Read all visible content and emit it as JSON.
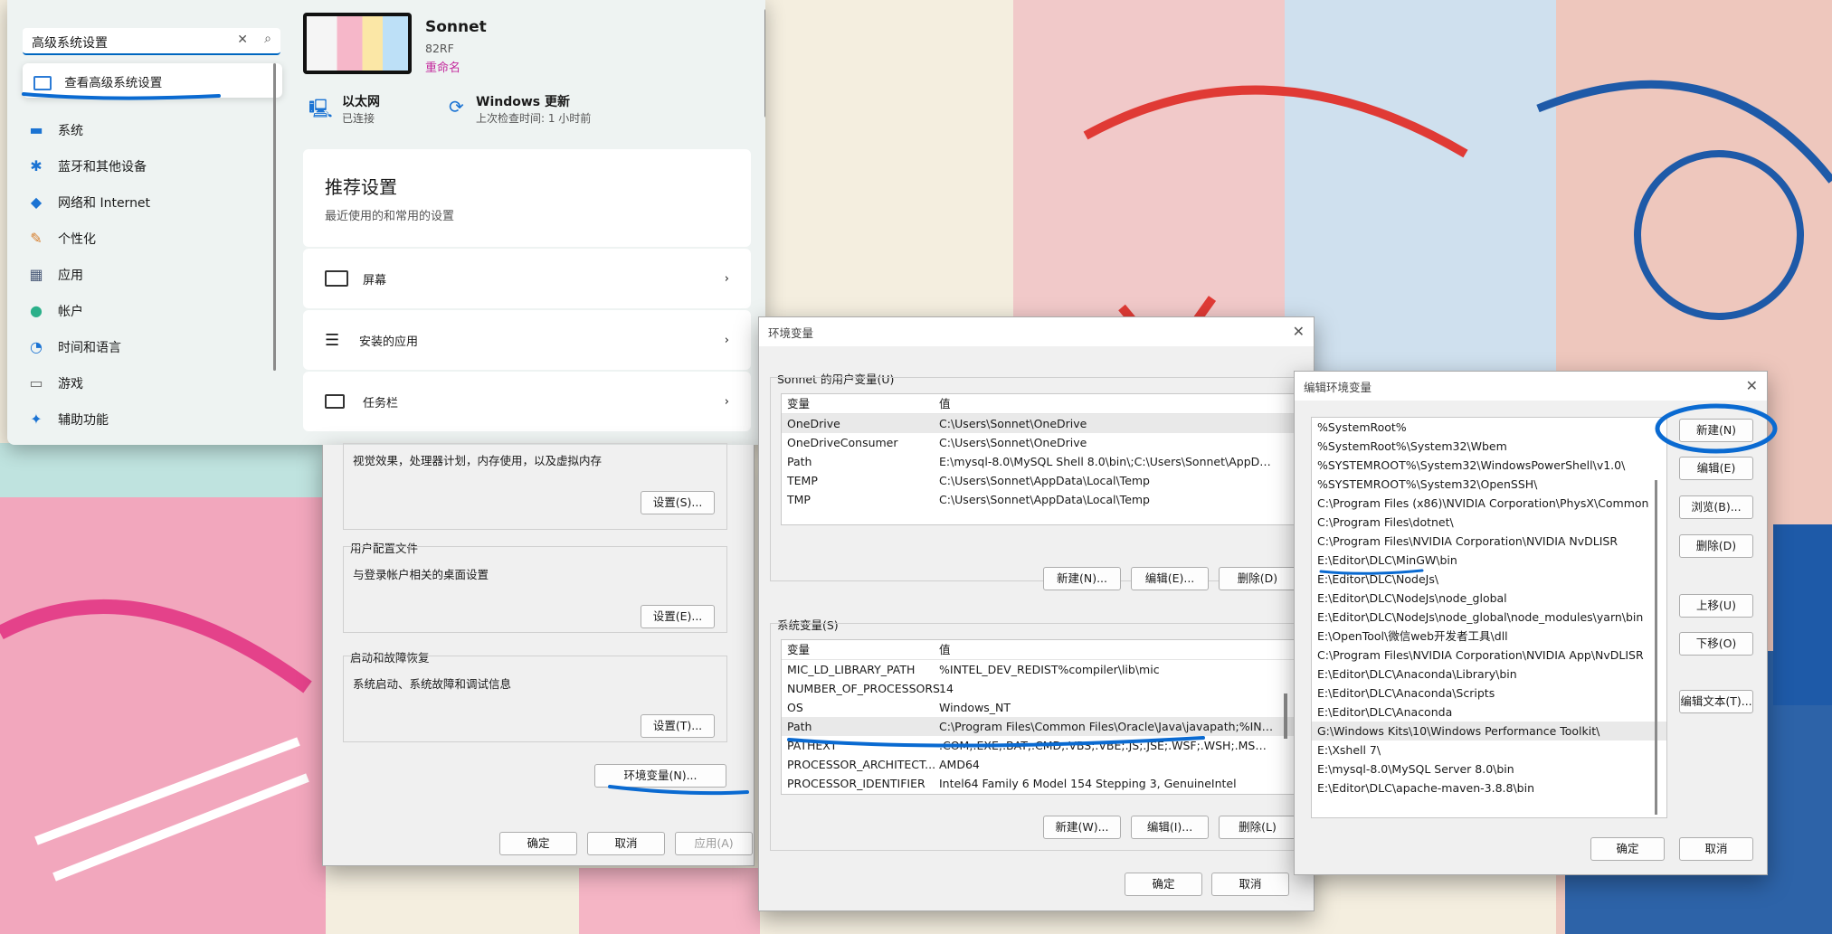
{
  "colors": {
    "accent": "#0067c0",
    "rename": "#c42b9e",
    "ink": "#0a6ad1"
  },
  "settings": {
    "search": {
      "value": "高级系统设置",
      "clear_icon": "close-icon",
      "search_icon": "search-icon"
    },
    "suggestion": "查看高级系统设置",
    "nav": [
      {
        "label": "系统",
        "icon": "monitor-icon"
      },
      {
        "label": "蓝牙和其他设备",
        "icon": "bluetooth-icon"
      },
      {
        "label": "网络和 Internet",
        "icon": "wifi-icon"
      },
      {
        "label": "个性化",
        "icon": "brush-icon"
      },
      {
        "label": "应用",
        "icon": "apps-icon"
      },
      {
        "label": "帐户",
        "icon": "person-icon"
      },
      {
        "label": "时间和语言",
        "icon": "clock-globe-icon"
      },
      {
        "label": "游戏",
        "icon": "gamepad-icon"
      },
      {
        "label": "辅助功能",
        "icon": "accessibility-icon"
      }
    ],
    "device": {
      "name": "Sonnet",
      "model": "82RF",
      "rename": "重命名"
    },
    "status": [
      {
        "title": "以太网",
        "sub": "已连接"
      },
      {
        "title": "Windows 更新",
        "sub": "上次检查时间: 1 小时前"
      }
    ],
    "recommended": {
      "title": "推荐设置",
      "subtitle": "最近使用的和常用的设置",
      "items": [
        "屏幕",
        "安装的应用",
        "任务栏"
      ]
    }
  },
  "sysprops": {
    "perf_desc": "视觉效果，处理器计划，内存使用，以及虚拟内存",
    "perf_btn": "设置(S)...",
    "profile_title": "用户配置文件",
    "profile_desc": "与登录帐户相关的桌面设置",
    "profile_btn": "设置(E)...",
    "startup_title": "启动和故障恢复",
    "startup_desc": "系统启动、系统故障和调试信息",
    "startup_btn": "设置(T)...",
    "env_btn": "环境变量(N)...",
    "ok": "确定",
    "cancel": "取消",
    "apply": "应用(A)"
  },
  "envvars": {
    "title": "环境变量",
    "user_section": "Sonnet 的用户变量(U)",
    "col_var": "变量",
    "col_val": "值",
    "user_vars": [
      [
        "OneDrive",
        "C:\\Users\\Sonnet\\OneDrive"
      ],
      [
        "OneDriveConsumer",
        "C:\\Users\\Sonnet\\OneDrive"
      ],
      [
        "Path",
        "E:\\mysql-8.0\\MySQL Shell 8.0\\bin\\;C:\\Users\\Sonnet\\AppData\\..."
      ],
      [
        "TEMP",
        "C:\\Users\\Sonnet\\AppData\\Local\\Temp"
      ],
      [
        "TMP",
        "C:\\Users\\Sonnet\\AppData\\Local\\Temp"
      ]
    ],
    "user_btns": [
      "新建(N)...",
      "编辑(E)...",
      "删除(D)"
    ],
    "sys_section": "系统变量(S)",
    "sys_vars": [
      [
        "MIC_LD_LIBRARY_PATH",
        "%INTEL_DEV_REDIST%compiler\\lib\\mic"
      ],
      [
        "NUMBER_OF_PROCESSORS",
        "14"
      ],
      [
        "OS",
        "Windows_NT"
      ],
      [
        "Path",
        "C:\\Program Files\\Common Files\\Oracle\\Java\\javapath;%INTE..."
      ],
      [
        "PATHEXT",
        ".COM;.EXE;.BAT;.CMD;.VBS;.VBE;.JS;.JSE;.WSF;.WSH;.MSC;.PY;.P..."
      ],
      [
        "PROCESSOR_ARCHITECT...",
        "AMD64"
      ],
      [
        "PROCESSOR_IDENTIFIER",
        "Intel64 Family 6 Model 154 Stepping 3, GenuineIntel"
      ]
    ],
    "sys_btns": [
      "新建(W)...",
      "编辑(I)...",
      "删除(L)"
    ],
    "ok": "确定",
    "cancel": "取消"
  },
  "editenv": {
    "title": "编辑环境变量",
    "paths": [
      "%SystemRoot%",
      "%SystemRoot%\\System32\\Wbem",
      "%SYSTEMROOT%\\System32\\WindowsPowerShell\\v1.0\\",
      "%SYSTEMROOT%\\System32\\OpenSSH\\",
      "C:\\Program Files (x86)\\NVIDIA Corporation\\PhysX\\Common",
      "C:\\Program Files\\dotnet\\",
      "C:\\Program Files\\NVIDIA Corporation\\NVIDIA NvDLISR",
      "E:\\Editor\\DLC\\MinGW\\bin",
      "E:\\Editor\\DLC\\NodeJs\\",
      "E:\\Editor\\DLC\\NodeJs\\node_global",
      "E:\\Editor\\DLC\\NodeJs\\node_global\\node_modules\\yarn\\bin",
      "E:\\OpenTool\\微信web开发者工具\\dll",
      "C:\\Program Files\\NVIDIA Corporation\\NVIDIA App\\NvDLISR",
      "E:\\Editor\\DLC\\Anaconda\\Library\\bin",
      "E:\\Editor\\DLC\\Anaconda\\Scripts",
      "E:\\Editor\\DLC\\Anaconda",
      "G:\\Windows Kits\\10\\Windows Performance Toolkit\\",
      "E:\\Xshell 7\\",
      "E:\\mysql-8.0\\MySQL Server 8.0\\bin",
      "E:\\Editor\\DLC\\apache-maven-3.8.8\\bin"
    ],
    "btns": [
      "新建(N)",
      "编辑(E)",
      "浏览(B)...",
      "删除(D)",
      "上移(U)",
      "下移(O)",
      "编辑文本(T)..."
    ],
    "ok": "确定",
    "cancel": "取消"
  }
}
